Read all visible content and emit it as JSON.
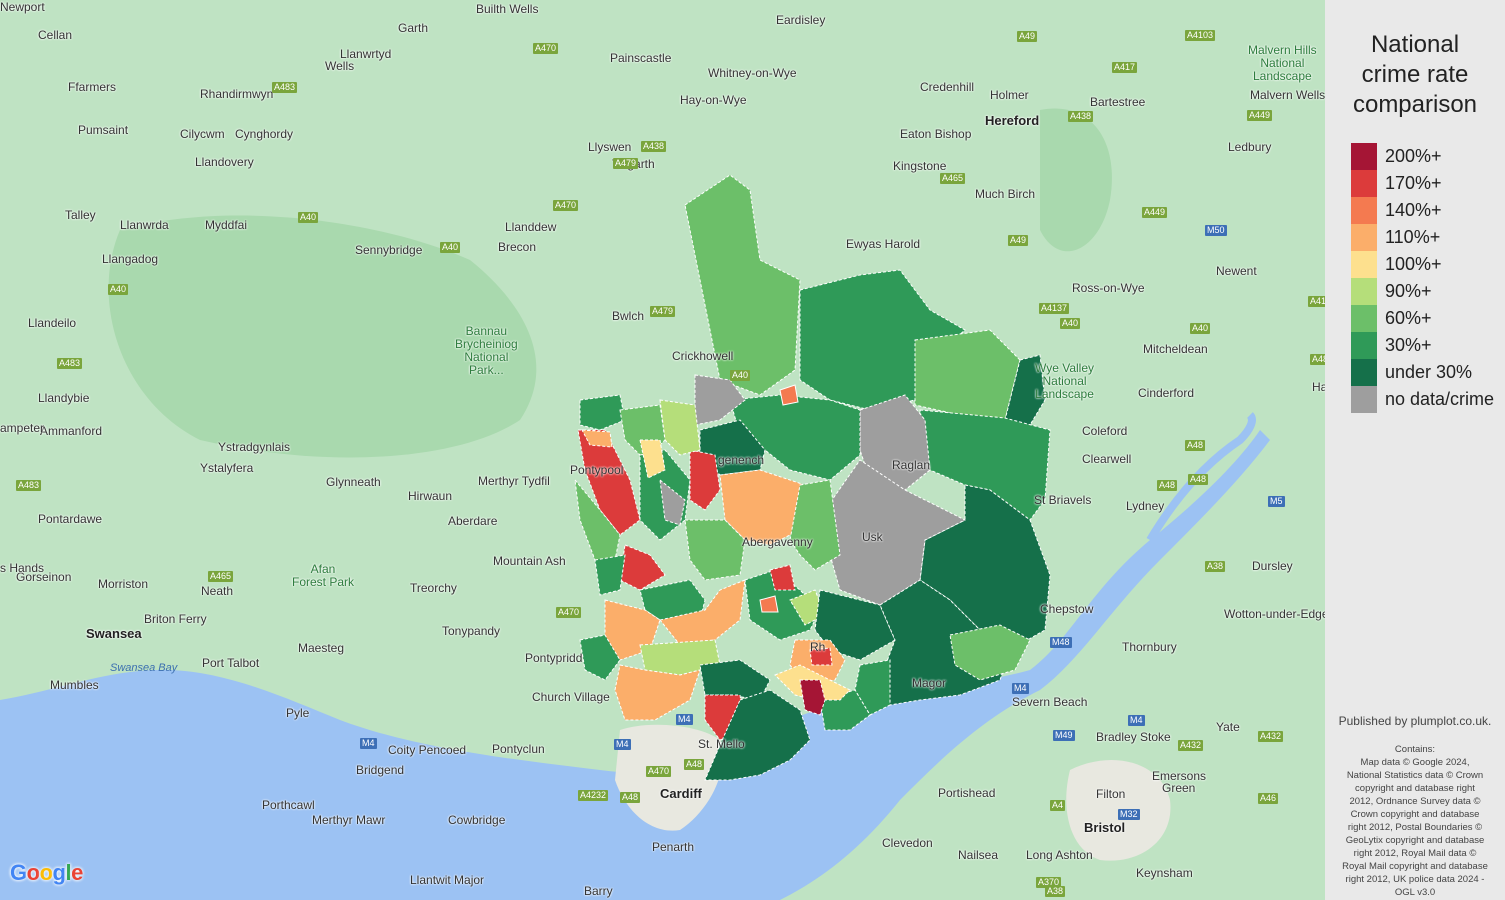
{
  "legend": {
    "title_lines": [
      "National",
      "crime rate",
      "comparison"
    ],
    "items": [
      {
        "label": "200%+",
        "color": "#a51535"
      },
      {
        "label": "170%+",
        "color": "#dc3b3b"
      },
      {
        "label": "140%+",
        "color": "#f47a50"
      },
      {
        "label": "110%+",
        "color": "#fbae6a"
      },
      {
        "label": "100%+",
        "color": "#fde08e"
      },
      {
        "label": "90%+",
        "color": "#b5de7a"
      },
      {
        "label": "60%+",
        "color": "#6cbf69"
      },
      {
        "label": "30%+",
        "color": "#2f9a58"
      },
      {
        "label": "under 30%",
        "color": "#15704a"
      },
      {
        "label": "no data/crime",
        "color": "#9e9e9e"
      }
    ]
  },
  "credits": {
    "published": "Published by plumplot.co.uk.",
    "contains_lines": [
      "Contains:",
      "Map data © Google 2024,",
      "National Statistics data © Crown",
      "copyright and database right",
      "2012, Ordnance Survey data ©",
      "Crown copyright and database",
      "right 2012, Postal Boundaries ©",
      "GeoLytix copyright and database",
      "right 2012, Royal Mail data ©",
      "Royal Mail copyright and database",
      "right 2012, UK police data 2024 -",
      "OGL v3.0"
    ],
    "google": [
      "G",
      "o",
      "o",
      "g",
      "l",
      "e"
    ],
    "google_colors": [
      "#4285f4",
      "#ea4335",
      "#fbbc05",
      "#4285f4",
      "#34a853",
      "#ea4335"
    ]
  },
  "places": [
    {
      "t": "Builth Wells"
    },
    {
      "t": "Eardisley"
    },
    {
      "t": "Cellan"
    },
    {
      "t": "Garth"
    },
    {
      "t": "Painscastle"
    },
    {
      "t": "Whitney-on-Wye"
    },
    {
      "t": "Credenhill"
    },
    {
      "t": "Holmer"
    },
    {
      "t": "Bartestree"
    },
    {
      "t": "Hereford"
    },
    {
      "t": "Malvern Wells"
    },
    {
      "t": "Ledbury"
    },
    {
      "t": "Ffarmers"
    },
    {
      "t": "Llanwrtyd"
    },
    {
      "t": "Wells"
    },
    {
      "t": "Rhandirmwyn"
    },
    {
      "t": "Hay-on-Wye"
    },
    {
      "t": "Eaton Bishop"
    },
    {
      "t": "Pumsaint"
    },
    {
      "t": "Cilycwm"
    },
    {
      "t": "Cynghordy"
    },
    {
      "t": "Llyswen"
    },
    {
      "t": "Talgarth"
    },
    {
      "t": "Kingstone"
    },
    {
      "t": "Llandovery"
    },
    {
      "t": "Much Birch"
    },
    {
      "t": "Talley"
    },
    {
      "t": "Llanwrda"
    },
    {
      "t": "Myddfai"
    },
    {
      "t": "Llanddew"
    },
    {
      "t": "Sennybridge"
    },
    {
      "t": "Brecon"
    },
    {
      "t": "Ewyas Harold"
    },
    {
      "t": "Newent"
    },
    {
      "t": "Llangadog"
    },
    {
      "t": "Ross-on-Wye"
    },
    {
      "t": "Llandeilo"
    },
    {
      "t": "Bwlch"
    },
    {
      "t": "Mitcheldean"
    },
    {
      "t": "Crickhowell"
    },
    {
      "t": "Llandybie"
    },
    {
      "t": "Cinderford"
    },
    {
      "t": "Ammanford"
    },
    {
      "t": "Ystradgynlais"
    },
    {
      "t": "Coleford"
    },
    {
      "t": "Ystalyfera"
    },
    {
      "t": "Clearwell"
    },
    {
      "t": "Glynneath"
    },
    {
      "t": "Hirwaun"
    },
    {
      "t": "Merthyr Tydfil"
    },
    {
      "t": "Lydney"
    },
    {
      "t": "Pontardawe"
    },
    {
      "t": "Aberdare"
    },
    {
      "t": "Mountain Ash"
    },
    {
      "t": "Dursley"
    },
    {
      "t": "Gorseinon"
    },
    {
      "t": "Morriston"
    },
    {
      "t": "Neath"
    },
    {
      "t": "Treorchy"
    },
    {
      "t": "Wotton-under-Edge"
    },
    {
      "t": "Swansea"
    },
    {
      "t": "Briton Ferry"
    },
    {
      "t": "Tonypandy"
    },
    {
      "t": "Thornbury"
    },
    {
      "t": "Port Talbot"
    },
    {
      "t": "Maesteg"
    },
    {
      "t": "Pontypridd"
    },
    {
      "t": "Mumbles"
    },
    {
      "t": "Church Village"
    },
    {
      "t": "Severn Beach"
    },
    {
      "t": "Yate"
    },
    {
      "t": "Pyle"
    },
    {
      "t": "Coity Pencoed"
    },
    {
      "t": "Pontyclun"
    },
    {
      "t": "St. Mello"
    },
    {
      "t": "Bradley Stoke"
    },
    {
      "t": "Bridgend"
    },
    {
      "t": "Filton"
    },
    {
      "t": "Emersons"
    },
    {
      "t": "Green"
    },
    {
      "t": "Porthcawl"
    },
    {
      "t": "Merthyr Mawr"
    },
    {
      "t": "Cardiff"
    },
    {
      "t": "Portishead"
    },
    {
      "t": "Cowbridge"
    },
    {
      "t": "Bristol"
    },
    {
      "t": "Penarth"
    },
    {
      "t": "Clevedon"
    },
    {
      "t": "Nailsea"
    },
    {
      "t": "Long Ashton"
    },
    {
      "t": "Keynsham"
    },
    {
      "t": "Llantwit Major"
    },
    {
      "t": "Barry"
    },
    {
      "t": "Usk"
    },
    {
      "t": "Raglan"
    },
    {
      "t": "Magor"
    },
    {
      "t": "St Briavels"
    },
    {
      "t": "Chepstow"
    },
    {
      "t": "Queen"
    },
    {
      "t": "Hardwi"
    },
    {
      "t": "ampeter"
    },
    {
      "t": "s Hands"
    },
    {
      "t": "genench"
    },
    {
      "t": "Abergavenny"
    },
    {
      "t": "Pontypool"
    },
    {
      "t": "Rh"
    },
    {
      "t": "Newport"
    }
  ],
  "parks": [
    {
      "lines": [
        "Malvern Hills",
        "National",
        "Landscape"
      ]
    },
    {
      "lines": [
        "Bannau",
        "Brycheiniog",
        "National",
        "Park..."
      ]
    },
    {
      "lines": [
        "Wye Valley",
        "National",
        "Landscape"
      ]
    },
    {
      "lines": [
        "Afan",
        "Forest Park"
      ]
    }
  ],
  "sea": [
    {
      "t": "Swansea Bay"
    }
  ],
  "roads": [
    {
      "t": "A470"
    },
    {
      "t": "A49"
    },
    {
      "t": "A4103"
    },
    {
      "t": "A417"
    },
    {
      "t": "A438"
    },
    {
      "t": "A449"
    },
    {
      "t": "A479"
    },
    {
      "t": "A438"
    },
    {
      "t": "A483"
    },
    {
      "t": "A40"
    },
    {
      "t": "A470"
    },
    {
      "t": "A465"
    },
    {
      "t": "A40"
    },
    {
      "t": "A449"
    },
    {
      "t": "A49"
    },
    {
      "t": "M50"
    },
    {
      "t": "A40"
    },
    {
      "t": "A479"
    },
    {
      "t": "A4137"
    },
    {
      "t": "A40"
    },
    {
      "t": "A40"
    },
    {
      "t": "A483"
    },
    {
      "t": "A40"
    },
    {
      "t": "A48"
    },
    {
      "t": "A483"
    },
    {
      "t": "A48"
    },
    {
      "t": "A48"
    },
    {
      "t": "A465"
    },
    {
      "t": "A470"
    },
    {
      "t": "M5"
    },
    {
      "t": "A38"
    },
    {
      "t": "M48"
    },
    {
      "t": "M4"
    },
    {
      "t": "M4"
    },
    {
      "t": "M4"
    },
    {
      "t": "M4"
    },
    {
      "t": "A48"
    },
    {
      "t": "A470"
    },
    {
      "t": "A4232"
    },
    {
      "t": "A48"
    },
    {
      "t": "M49"
    },
    {
      "t": "A432"
    },
    {
      "t": "A432"
    },
    {
      "t": "M32"
    },
    {
      "t": "A4"
    },
    {
      "t": "A46"
    },
    {
      "t": "A370"
    },
    {
      "t": "A38"
    },
    {
      "t": "M4"
    },
    {
      "t": "A41"
    },
    {
      "t": "A48"
    }
  ]
}
